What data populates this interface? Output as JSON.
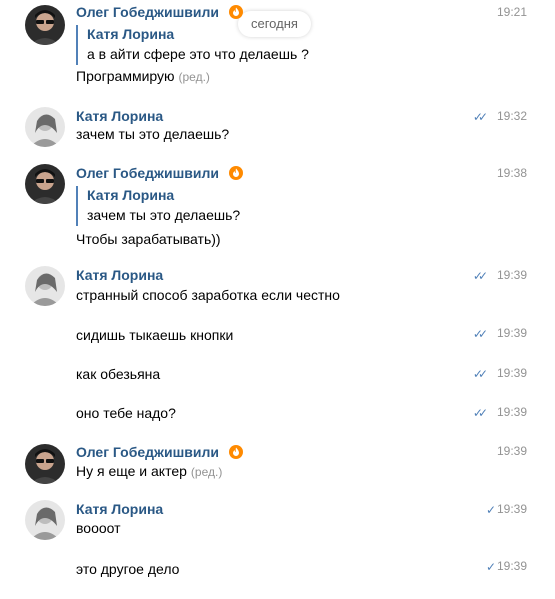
{
  "date_separator": "сегодня",
  "users": {
    "oleg": "Олег Гобеджишвили",
    "katya": "Катя Лорина"
  },
  "edited_label": "(ред.)",
  "messages": [
    {
      "author": "Олег Гобеджишвили",
      "time": "19:21",
      "quote_author": "Катя Лорина",
      "quote_text": "а в айти сфере это что делаешь ?",
      "text": "Программирую"
    },
    {
      "author": "Катя Лорина",
      "time": "19:32",
      "text": "зачем ты это делаешь?"
    },
    {
      "author": "Олег Гобеджишвили",
      "time": "19:38",
      "quote_author": "Катя Лорина",
      "quote_text": "зачем ты это делаешь?",
      "text": "Чтобы зарабатывать))"
    },
    {
      "author": "Катя Лорина",
      "time": "19:39",
      "text": "странный способ заработка если честно"
    },
    {
      "time": "19:39",
      "text": "сидишь тыкаешь кнопки"
    },
    {
      "time": "19:39",
      "text": "как обезьяна"
    },
    {
      "time": "19:39",
      "text": "оно тебе надо?"
    },
    {
      "author": "Олег Гобеджишвили",
      "time": "19:39",
      "text": "Ну я еще и актер"
    },
    {
      "author": "Катя Лорина",
      "time": "19:39",
      "text": "воооот"
    },
    {
      "time": "19:39",
      "text": "это другое дело"
    }
  ],
  "icons": {
    "verified": "verified-flame-icon",
    "read": "double-check-icon",
    "sent": "single-check-icon"
  },
  "colors": {
    "author": "#2a5885",
    "check": "#5181b8",
    "time": "#939393",
    "badge": "#ff8a00"
  }
}
